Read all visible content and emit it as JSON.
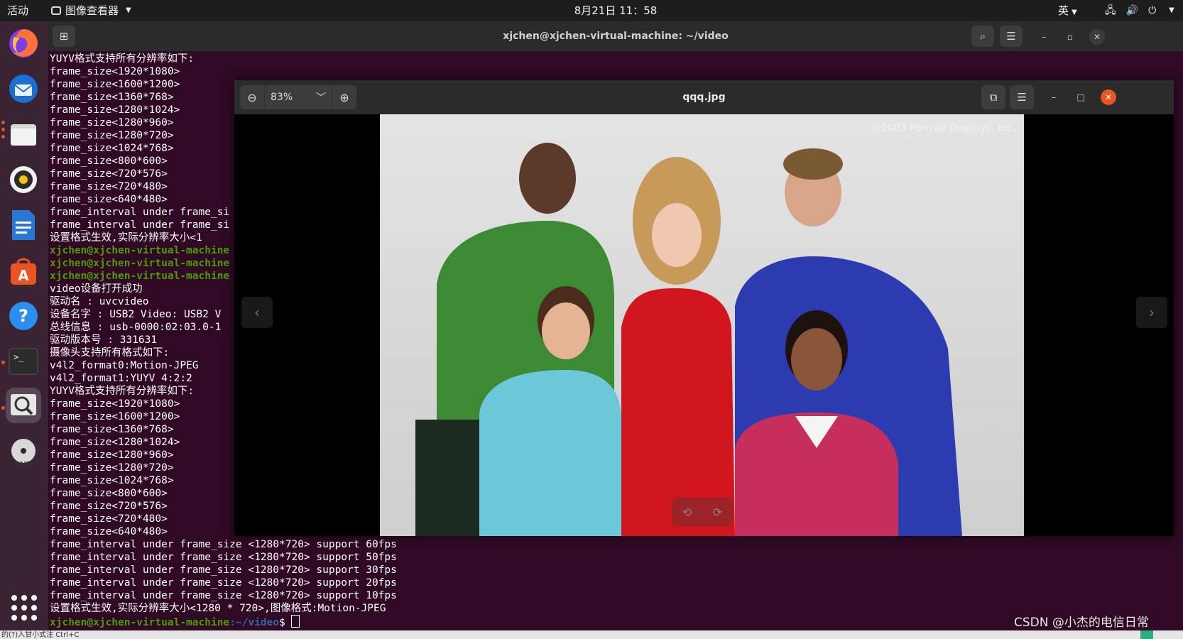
{
  "topbar": {
    "activities": "活动",
    "app_name": "图像查看器",
    "clock": "8月21日  11：58",
    "input_method": "英"
  },
  "dock": {
    "apps": [
      "Firefox",
      "Thunderbird",
      "Files",
      "Rhythmbox",
      "LibreOffice Writer",
      "Ubuntu Software",
      "Help",
      "Terminal",
      "Image Viewer",
      "DVD"
    ]
  },
  "terminal": {
    "title": "xjchen@xjchen-virtual-machine: ~/video",
    "lines": [
      "YUYV格式支持所有分辨率如下:",
      "frame_size<1920*1080>",
      "frame_size<1600*1200>",
      "frame_size<1360*768>",
      "frame_size<1280*1024>",
      "frame_size<1280*960>",
      "frame_size<1280*720>",
      "frame_size<1024*768>",
      "frame_size<800*600>",
      "frame_size<720*576>",
      "frame_size<720*480>",
      "frame_size<640*480>",
      "frame_interval under frame_si",
      "frame_interval under frame_si",
      "设置格式生效,实际分辨率大小<1",
      "xjchen@xjchen-virtual-machine",
      "xjchen@xjchen-virtual-machine",
      "xjchen@xjchen-virtual-machine",
      "video设备打开成功",
      "驱动名 : uvcvideo",
      "设备名字 : USB2 Video: USB2 V",
      "总线信息 : usb-0000:02:03.0-1",
      "驱动版本号 : 331631",
      "摄像头支持所有格式如下:",
      "v4l2_format0:Motion-JPEG",
      "v4l2_format1:YUYV 4:2:2",
      "YUYV格式支持所有分辨率如下:",
      "frame_size<1920*1080>",
      "frame_size<1600*1200>",
      "frame_size<1360*768>",
      "frame_size<1280*1024>",
      "frame_size<1280*960>",
      "frame_size<1280*720>",
      "frame_size<1024*768>",
      "frame_size<800*600>",
      "frame_size<720*576>",
      "frame_size<720*480>",
      "frame_size<640*480>",
      "frame_interval under frame_size <1280*720> support 60fps",
      "frame_interval under frame_size <1280*720> support 50fps",
      "frame_interval under frame_size <1280*720> support 30fps",
      "frame_interval under frame_size <1280*720> support 20fps",
      "frame_interval under frame_size <1280*720> support 10fps",
      "设置格式生效,实际分辨率大小<1280 * 720>,图像格式:Motion-JPEG"
    ],
    "prompt_user": "xjchen@xjchen-virtual-machine",
    "prompt_path": ":~/video",
    "prompt_symbol": "$ "
  },
  "viewer": {
    "title": "qqq.jpg",
    "zoom": "83%",
    "copyright": "©2003 Portrait Displays, Inc."
  },
  "watermark": "CSDN @小杰的电信日常",
  "bottom_text": "的(?)入甘小式注 Ctrl+C"
}
